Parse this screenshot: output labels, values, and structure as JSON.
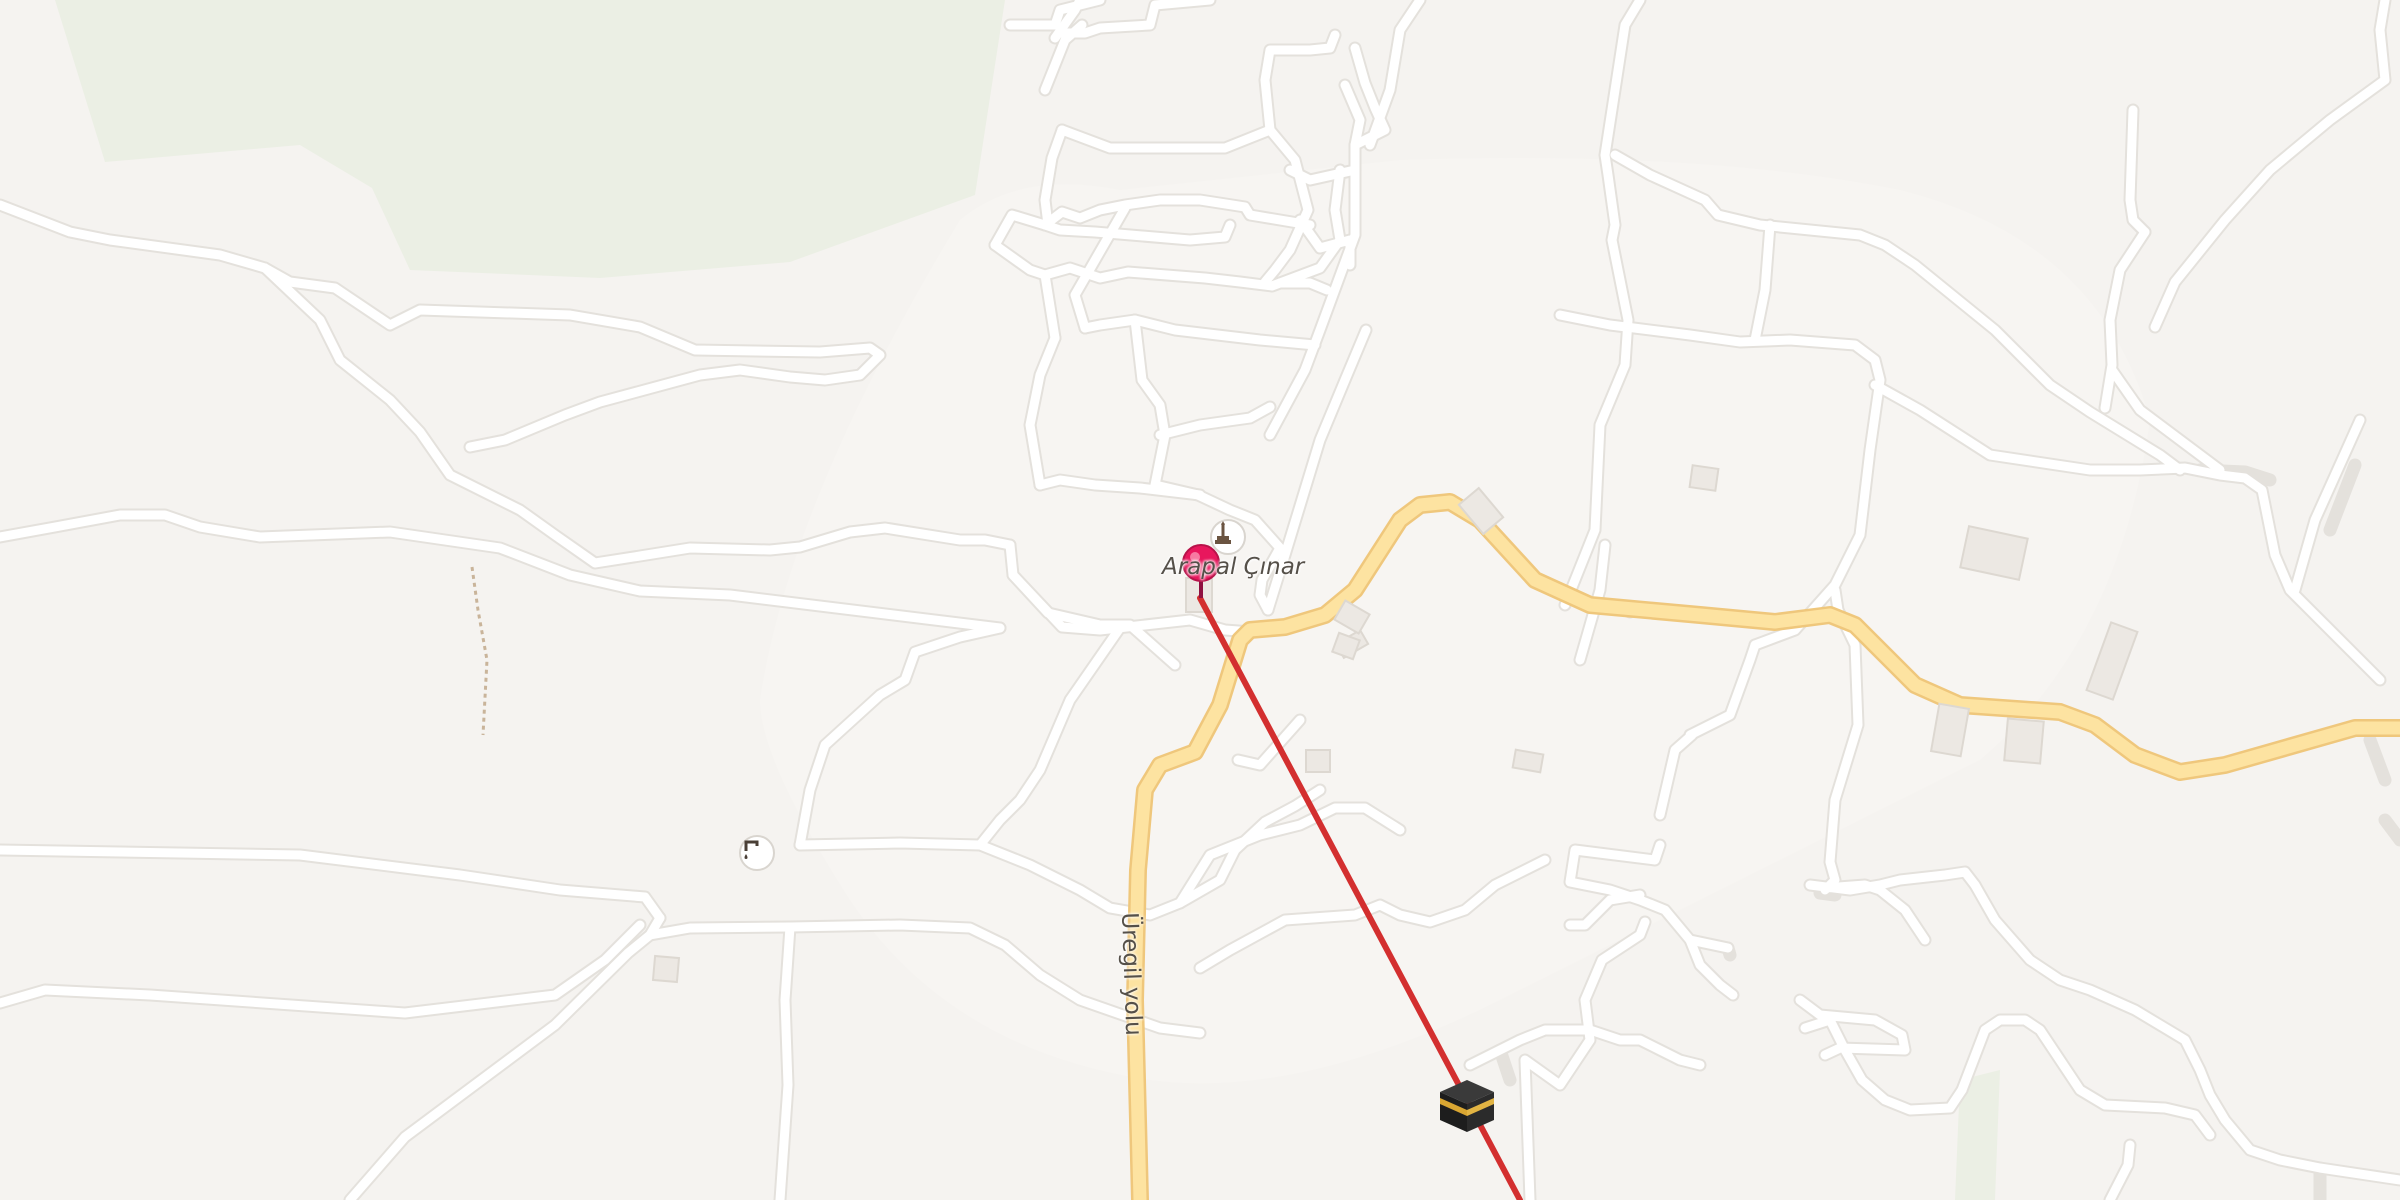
{
  "map": {
    "place_name": "Arapal Çınar",
    "road_name": "Üregil yolu",
    "colors": {
      "land": "#f5f3f0",
      "park": "#ebefe4",
      "road": "#ffffff",
      "main_road": "#fde3a1",
      "qibla_line": "#d32f2f",
      "pin": "#e8175d"
    },
    "pois": [
      {
        "icon": "mosque-icon"
      },
      {
        "icon": "fountain-icon"
      },
      {
        "icon": "kaaba-icon"
      }
    ],
    "pin": {
      "icon": "location-pin-icon"
    }
  }
}
